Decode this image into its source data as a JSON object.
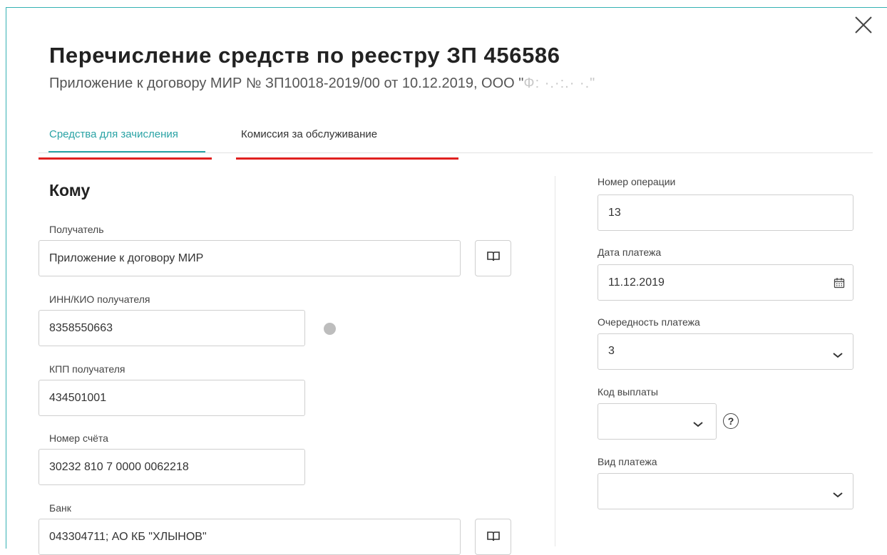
{
  "dialog": {
    "title": "Перечисление средств по реестру ЗП 456586",
    "subtitle": "Приложение к договору МИР № ЗП10018-2019/00 от 10.12.2019, ООО \"",
    "subtitle_blurred": "Ф: ·.·:.· ·.\""
  },
  "tabs": [
    {
      "label": "Средства для зачисления",
      "active": true
    },
    {
      "label": "Комиссия за обслуживание",
      "active": false
    }
  ],
  "left": {
    "section_title": "Кому",
    "recipient": {
      "label": "Получатель",
      "value": "Приложение к договору МИР"
    },
    "inn": {
      "label": "ИНН/КИО получателя",
      "value": "8358550663"
    },
    "kpp": {
      "label": "КПП получателя",
      "value": "434501001"
    },
    "account": {
      "label": "Номер счёта",
      "value": "30232 810 7 0000 0062218"
    },
    "bank": {
      "label": "Банк",
      "value": "043304711; АО КБ \"ХЛЫНОВ\""
    }
  },
  "right": {
    "operation_number": {
      "label": "Номер операции",
      "value": "13"
    },
    "payment_date": {
      "label": "Дата платежа",
      "value": "11.12.2019"
    },
    "priority": {
      "label": "Очередность платежа",
      "value": "3"
    },
    "payout_code": {
      "label": "Код выплаты",
      "value": "",
      "help_glyph": "?"
    },
    "payment_type": {
      "label": "Вид платежа",
      "value": ""
    }
  },
  "colors": {
    "accent": "#2aa3a5",
    "annotation": "#e0201f",
    "frame": "#35b1b3"
  }
}
